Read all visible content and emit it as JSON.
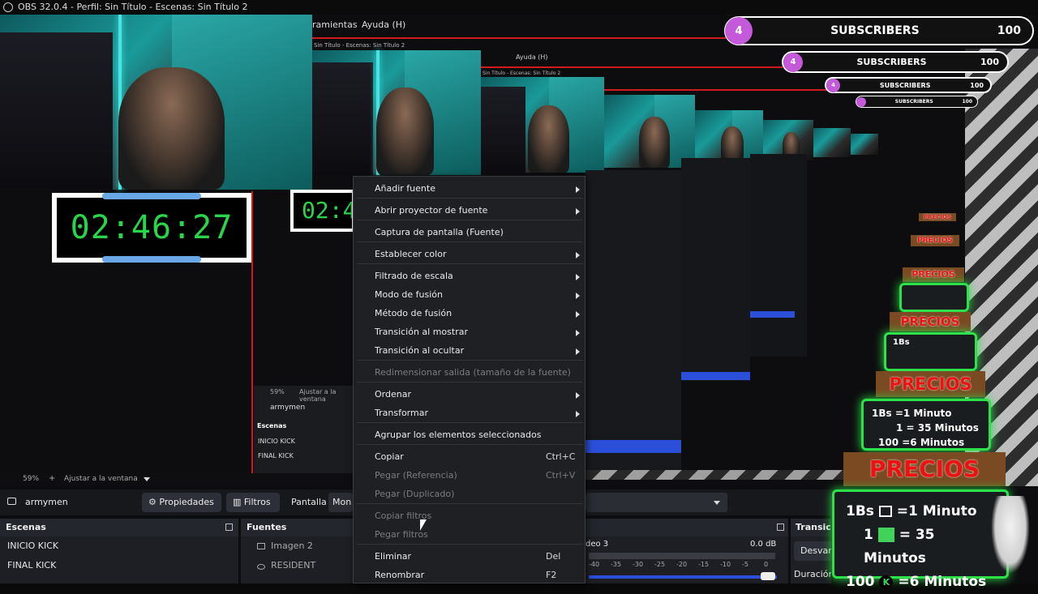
{
  "window": {
    "title": "OBS 32.0.4 - Perfil: Sin Título - Escenas: Sin Título 2"
  },
  "menubar": {
    "items": [
      "ramientas",
      "Ayuda (H)"
    ],
    "nested_title": "Sin Título - Escenas: Sin Título 2"
  },
  "timer": {
    "value": "02:46:27",
    "partial": "02:4"
  },
  "subscribers": {
    "count_circle": "4",
    "label": "SUBSCRIBERS",
    "goal": "100"
  },
  "preview": {
    "zoom": "59%",
    "zoom_plus": "+",
    "fit_label": "Ajustar a la ventana"
  },
  "nested_preview": {
    "zoom": "59%",
    "fit_label": "Ajustar a la ventana",
    "source_name": "armymen",
    "scenes_header": "Escenas",
    "scenes": [
      "INICIO KICK",
      "FINAL KICK"
    ]
  },
  "source_toolbar": {
    "source_name": "armymen",
    "properties_label": "Propiedades",
    "filters_label": "Filtros",
    "screen_label": "Pantalla",
    "screen_value": "Mon"
  },
  "docks": {
    "scenes": {
      "title": "Escenas",
      "items": [
        "INICIO KICK",
        "FINAL KICK"
      ]
    },
    "sources": {
      "title": "Fuentes",
      "items": [
        "Imagen 2",
        "RESIDENT"
      ]
    },
    "mixer": {
      "channel": "deo 3",
      "db": "0.0 dB",
      "ticks": [
        "-40",
        "-35",
        "-30",
        "-25",
        "-20",
        "-15",
        "-10",
        "-5",
        "0"
      ]
    },
    "transitions": {
      "title": "Transiciones de escena",
      "selected": "Desvanecimiento",
      "duration_label": "Duración"
    }
  },
  "context_menu": {
    "items": [
      {
        "label": "Añadir fuente",
        "submenu": true,
        "disabled": false,
        "shortcut": ""
      },
      {
        "label": "Abrir proyector de fuente",
        "submenu": true,
        "disabled": false,
        "shortcut": ""
      },
      {
        "label": "Captura de pantalla (Fuente)",
        "submenu": false,
        "disabled": false,
        "shortcut": ""
      },
      {
        "label": "Establecer color",
        "submenu": true,
        "disabled": false,
        "shortcut": ""
      },
      {
        "label": "Filtrado de escala",
        "submenu": true,
        "disabled": false,
        "shortcut": ""
      },
      {
        "label": "Modo de fusión",
        "submenu": true,
        "disabled": false,
        "shortcut": ""
      },
      {
        "label": "Método de fusión",
        "submenu": true,
        "disabled": false,
        "shortcut": ""
      },
      {
        "label": "Transición al mostrar",
        "submenu": true,
        "disabled": false,
        "shortcut": ""
      },
      {
        "label": "Transición al ocultar",
        "submenu": true,
        "disabled": false,
        "shortcut": ""
      },
      {
        "label": "Redimensionar salida (tamaño de la fuente)",
        "submenu": false,
        "disabled": true,
        "shortcut": ""
      },
      {
        "label": "Ordenar",
        "submenu": true,
        "disabled": false,
        "shortcut": ""
      },
      {
        "label": "Transformar",
        "submenu": true,
        "disabled": false,
        "shortcut": ""
      },
      {
        "label": "Agrupar los elementos seleccionados",
        "submenu": false,
        "disabled": false,
        "shortcut": ""
      },
      {
        "label": "Copiar",
        "submenu": false,
        "disabled": false,
        "shortcut": "Ctrl+C"
      },
      {
        "label": "Pegar (Referencia)",
        "submenu": false,
        "disabled": true,
        "shortcut": "Ctrl+V"
      },
      {
        "label": "Pegar (Duplicado)",
        "submenu": false,
        "disabled": true,
        "shortcut": ""
      },
      {
        "label": "Copiar filtros",
        "submenu": false,
        "disabled": true,
        "shortcut": ""
      },
      {
        "label": "Pegar filtros",
        "submenu": false,
        "disabled": true,
        "shortcut": ""
      },
      {
        "label": "Eliminar",
        "submenu": false,
        "disabled": false,
        "shortcut": "Del"
      },
      {
        "label": "Renombrar",
        "submenu": false,
        "disabled": false,
        "shortcut": "F2"
      }
    ]
  },
  "price_overlay": {
    "header": "PRECIOS",
    "lines": [
      {
        "qty": "1Bs",
        "eq": "=1 Minuto"
      },
      {
        "qty": "1",
        "eq": "= 35 Minutos"
      },
      {
        "qty": "100",
        "eq": "=6 Minutos"
      }
    ]
  },
  "colors": {
    "accent_green": "#2ee04a",
    "timer_green": "#29d64a",
    "sub_purple": "#c45ad9",
    "selection_blue": "#2b4fd8",
    "guide_red": "#d01c1c"
  }
}
